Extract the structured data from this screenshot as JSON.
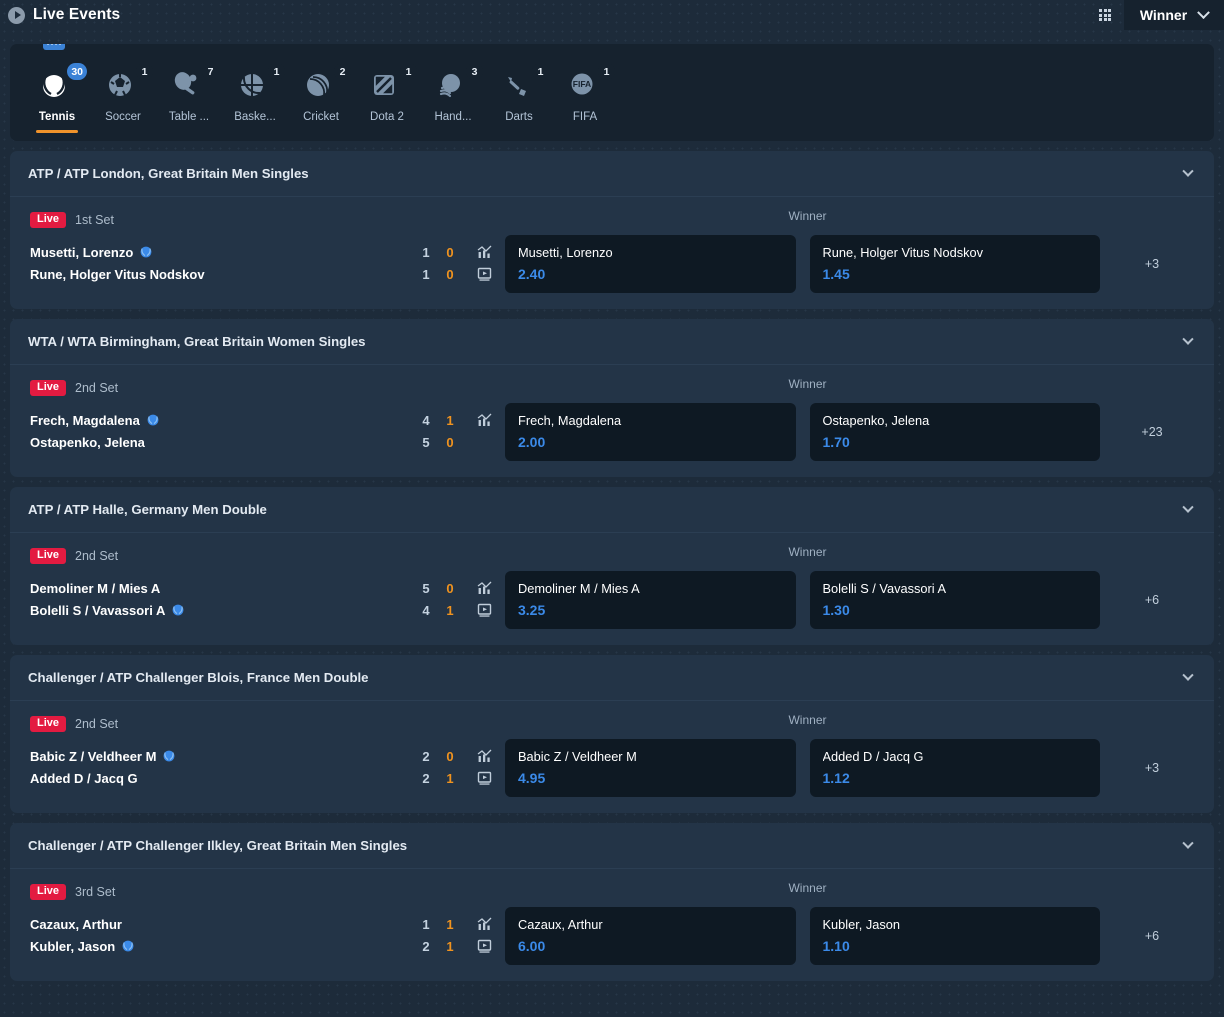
{
  "header": {
    "title": "Live Events",
    "play_icon": "play-circle-icon",
    "grid_icon": "grid-view-icon",
    "market_selector": {
      "label": "Winner",
      "chevron_icon": "chevron-down-icon"
    }
  },
  "sports": [
    {
      "name": "Tennis",
      "count": "30",
      "active": true,
      "icon": "tennis-ball-icon"
    },
    {
      "name": "Soccer",
      "count": "1",
      "active": false,
      "icon": "soccer-ball-icon"
    },
    {
      "name": "Table ...",
      "count": "7",
      "active": false,
      "icon": "table-tennis-icon"
    },
    {
      "name": "Baske...",
      "count": "1",
      "active": false,
      "icon": "basketball-icon"
    },
    {
      "name": "Cricket",
      "count": "2",
      "active": false,
      "icon": "cricket-ball-icon"
    },
    {
      "name": "Dota 2",
      "count": "1",
      "active": false,
      "icon": "dota2-icon"
    },
    {
      "name": "Hand...",
      "count": "3",
      "active": false,
      "icon": "handball-icon"
    },
    {
      "name": "Darts",
      "count": "1",
      "active": false,
      "icon": "darts-icon"
    },
    {
      "name": "FIFA",
      "count": "1",
      "active": false,
      "icon": "fifa-icon"
    }
  ],
  "events": [
    {
      "league": "ATP / ATP London, Great Britain Men Singles",
      "status": "Live",
      "set": "1st Set",
      "market": "Winner",
      "home": {
        "name": "Musetti, Lorenzo",
        "serving": true,
        "sets": "1",
        "games": "0"
      },
      "away": {
        "name": "Rune, Holger Vitus Nodskov",
        "serving": false,
        "sets": "1",
        "games": "0"
      },
      "stats_icon": "statistics-chart-icon",
      "video_icon": "live-video-icon",
      "has_video": true,
      "odds": [
        {
          "name": "Musetti, Lorenzo",
          "value": "2.40"
        },
        {
          "name": "Rune, Holger Vitus Nodskov",
          "value": "1.45"
        }
      ],
      "more_markets": "+3"
    },
    {
      "league": "WTA / WTA Birmingham, Great Britain Women Singles",
      "status": "Live",
      "set": "2nd Set",
      "market": "Winner",
      "home": {
        "name": "Frech, Magdalena",
        "serving": true,
        "sets": "4",
        "games": "1"
      },
      "away": {
        "name": "Ostapenko, Jelena",
        "serving": false,
        "sets": "5",
        "games": "0"
      },
      "stats_icon": "statistics-chart-icon",
      "video_icon": "live-video-icon",
      "has_video": false,
      "odds": [
        {
          "name": "Frech, Magdalena",
          "value": "2.00"
        },
        {
          "name": "Ostapenko, Jelena",
          "value": "1.70"
        }
      ],
      "more_markets": "+23"
    },
    {
      "league": "ATP / ATP Halle, Germany Men Double",
      "status": "Live",
      "set": "2nd Set",
      "market": "Winner",
      "home": {
        "name": "Demoliner M / Mies A",
        "serving": false,
        "sets": "5",
        "games": "0"
      },
      "away": {
        "name": "Bolelli S / Vavassori A",
        "serving": true,
        "sets": "4",
        "games": "1"
      },
      "stats_icon": "statistics-chart-icon",
      "video_icon": "live-video-icon",
      "has_video": true,
      "odds": [
        {
          "name": "Demoliner M / Mies A",
          "value": "3.25"
        },
        {
          "name": "Bolelli S / Vavassori A",
          "value": "1.30"
        }
      ],
      "more_markets": "+6"
    },
    {
      "league": "Challenger / ATP Challenger Blois, France Men Double",
      "status": "Live",
      "set": "2nd Set",
      "market": "Winner",
      "home": {
        "name": "Babic Z / Veldheer M",
        "serving": true,
        "sets": "2",
        "games": "0"
      },
      "away": {
        "name": "Added D / Jacq G",
        "serving": false,
        "sets": "2",
        "games": "1"
      },
      "stats_icon": "statistics-chart-icon",
      "video_icon": "live-video-icon",
      "has_video": true,
      "odds": [
        {
          "name": "Babic Z / Veldheer M",
          "value": "4.95"
        },
        {
          "name": "Added D / Jacq G",
          "value": "1.12"
        }
      ],
      "more_markets": "+3"
    },
    {
      "league": "Challenger / ATP Challenger Ilkley, Great Britain Men Singles",
      "status": "Live",
      "set": "3rd Set",
      "market": "Winner",
      "home": {
        "name": "Cazaux, Arthur",
        "serving": false,
        "sets": "1",
        "games": "1"
      },
      "away": {
        "name": "Kubler, Jason",
        "serving": true,
        "sets": "2",
        "games": "1"
      },
      "stats_icon": "statistics-chart-icon",
      "video_icon": "live-video-icon",
      "has_video": true,
      "odds": [
        {
          "name": "Cazaux, Arthur",
          "value": "6.00"
        },
        {
          "name": "Kubler, Jason",
          "value": "1.10"
        }
      ],
      "more_markets": "+6"
    }
  ],
  "colors": {
    "page_bg": "#1d2b3a",
    "panel_bg": "#16222e",
    "card_bg": "#233447",
    "odd_bg": "#0e1923",
    "accent_blue": "#3b8ae8",
    "accent_orange": "#f0931f",
    "live_red": "#e31b41",
    "active_underline": "#f0932b"
  }
}
